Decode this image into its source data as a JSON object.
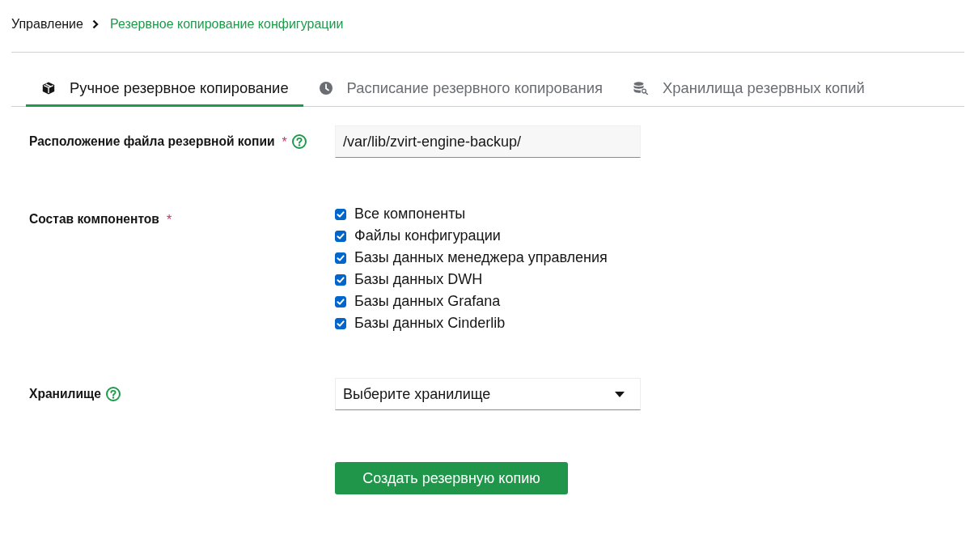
{
  "breadcrumb": [
    {
      "label": "Управление",
      "current": false
    },
    {
      "label": "Резервное копирование конфигурации",
      "current": true
    }
  ],
  "tabs": [
    {
      "label": "Ручное резервное копирование",
      "selected": true
    },
    {
      "label": "Расписание резервного копирования",
      "selected": false
    },
    {
      "label": "Хранилища резервных копий",
      "selected": false
    }
  ],
  "form": {
    "fields": [
      {
        "kind": "text",
        "label": "Расположение файла резервной копии",
        "required_mark": "*",
        "help": true,
        "value": "/var/lib/zvirt-engine-backup/"
      },
      {
        "kind": "checkboxes",
        "label": "Состав компонентов",
        "required_mark": "*",
        "help": false,
        "options": [
          {
            "label": "Все компоненты",
            "checked": true
          },
          {
            "label": "Файлы конфигурации",
            "checked": true
          },
          {
            "label": "Базы данных менеджера управления",
            "checked": true
          },
          {
            "label": "Базы данных DWH",
            "checked": true
          },
          {
            "label": "Базы данных Grafana",
            "checked": true
          },
          {
            "label": "Базы данных Cinderlib",
            "checked": true
          }
        ]
      },
      {
        "kind": "select",
        "label": "Хранилище",
        "help": true,
        "placeholder": "Выберите хранилище"
      }
    ]
  },
  "submit_button": "Создать резервную копию"
}
